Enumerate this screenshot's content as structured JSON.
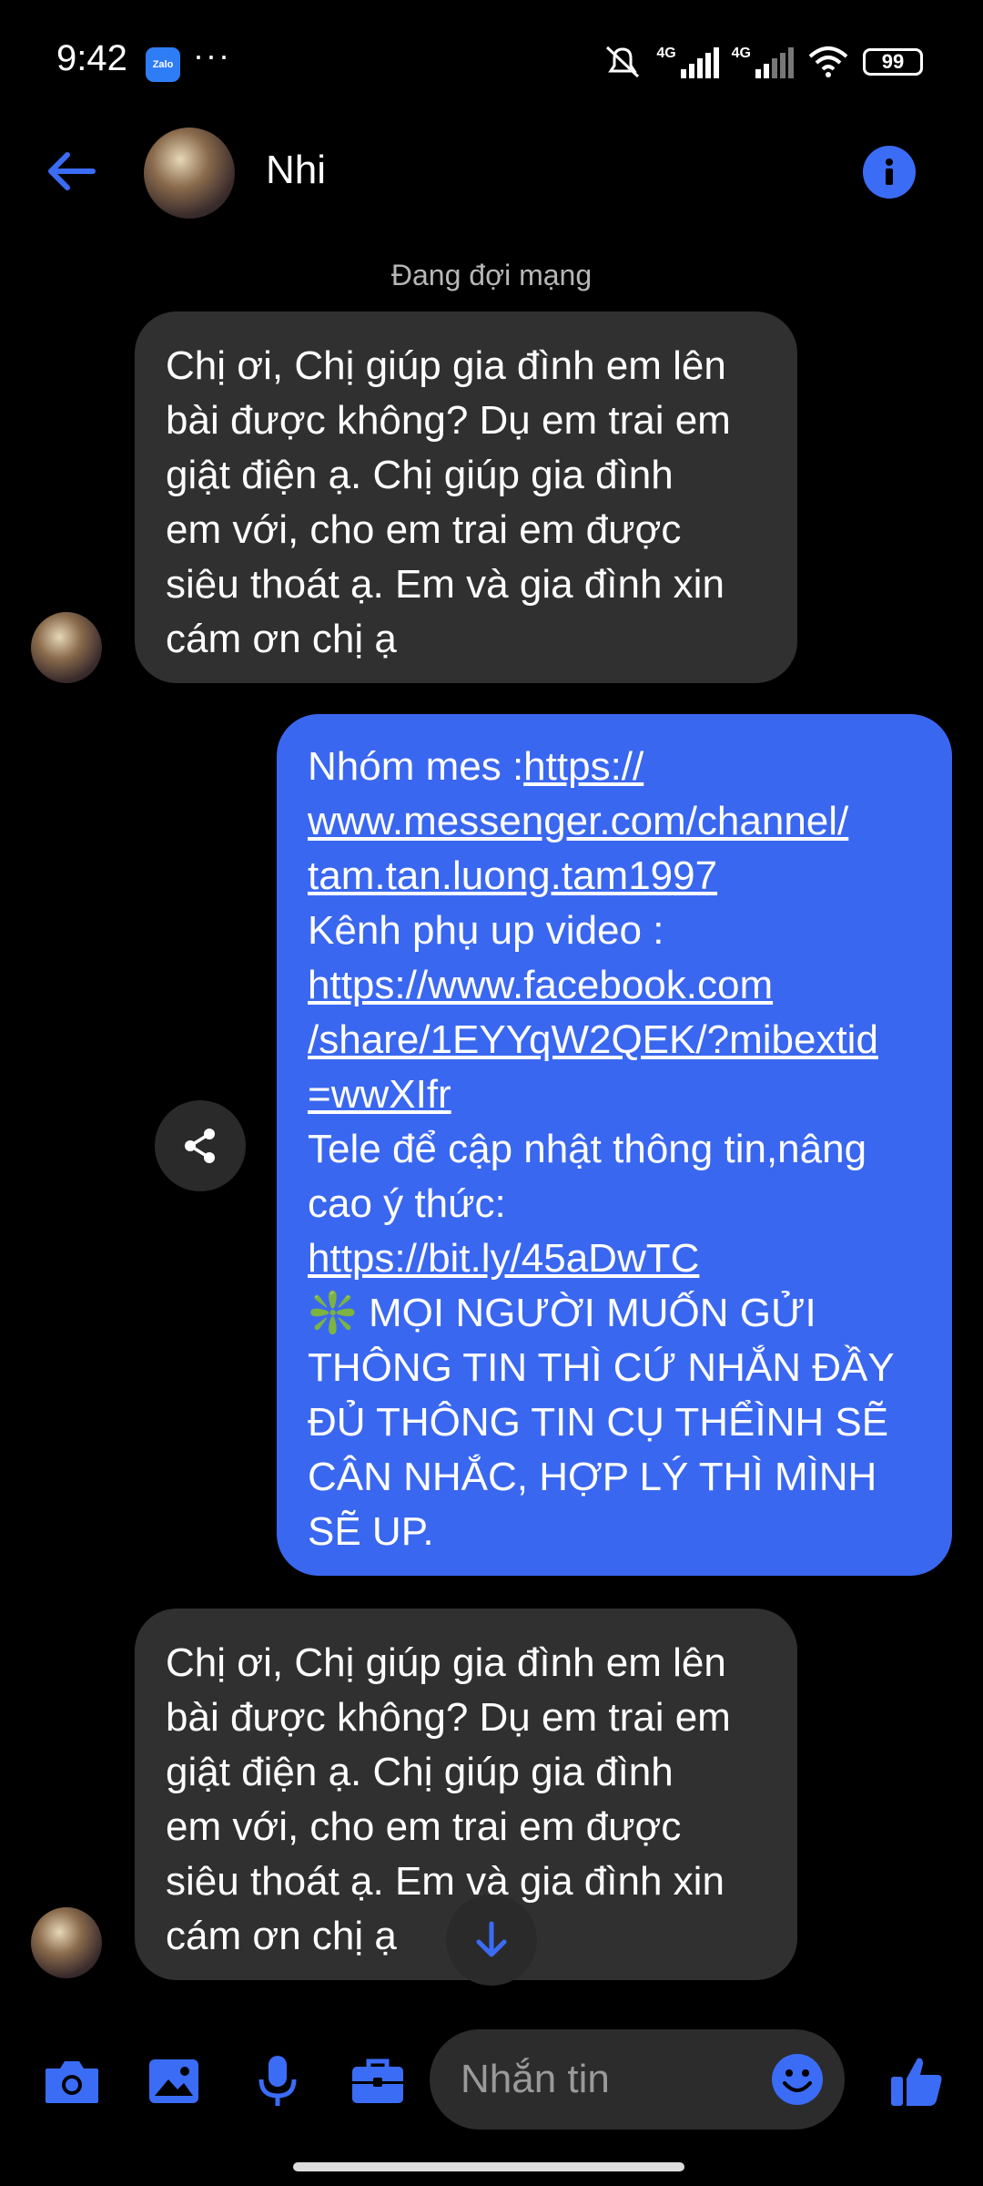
{
  "status_bar": {
    "time": "9:42",
    "app_badge": "Zalo",
    "more": "···",
    "network_1": "4G",
    "network_2": "4G",
    "battery": "99"
  },
  "header": {
    "contact_name": "Nhi"
  },
  "network_status": "Đang đợi mạng",
  "messages": [
    {
      "direction": "incoming",
      "text": "Chị ơi, Chị giúp gia đình em lên\nbài được không? Dụ em trai em\ngiật điện ạ. Chị giúp gia đình\nem với, cho em trai em được\nsiêu thoát ạ. Em và gia đình xin\ncám ơn chị ạ"
    },
    {
      "direction": "outgoing",
      "group_label": "Nhóm mes :",
      "group_link": "https://\nwww.messenger.com/channel/\ntam.tan.luong.tam1997",
      "video_label": "Kênh phụ up video :",
      "video_link": "https://www.facebook.com\n/share/1EYYqW2QEK/?mibextid\n=wwXIfr",
      "tele_label": "Tele để cập nhật thông tin,nâng\ncao ý thức:",
      "tele_link": "https://bit.ly/45aDwTC",
      "notice_icon": "❇️",
      "notice": " MỌI NGƯỜI MUỐN GỬI\nTHÔNG TIN THÌ CỨ NHẮN ĐẦY\nĐỦ THÔNG TIN CỤ THỂÌNH SẼ\nCÂN NHẮC,  HỢP LÝ THÌ MÌNH\nSẼ UP."
    },
    {
      "direction": "incoming",
      "text": "Chị ơi, Chị giúp gia đình em lên\nbài được không? Dụ em trai em\ngiật điện ạ. Chị giúp gia đình\nem với, cho em trai em được\nsiêu thoát ạ. Em và gia đình xin\ncám ơn chị ạ"
    }
  ],
  "composer": {
    "placeholder": "Nhắn tin"
  },
  "colors": {
    "accent": "#3b6cf6",
    "outgoing_bubble": "#3a67f0",
    "incoming_bubble": "#303030",
    "background": "#000000"
  },
  "icons": [
    "back-arrow-icon",
    "info-icon",
    "share-icon",
    "scroll-down-icon",
    "camera-icon",
    "image-icon",
    "microphone-icon",
    "briefcase-icon",
    "emoji-icon",
    "thumbs-up-icon"
  ]
}
